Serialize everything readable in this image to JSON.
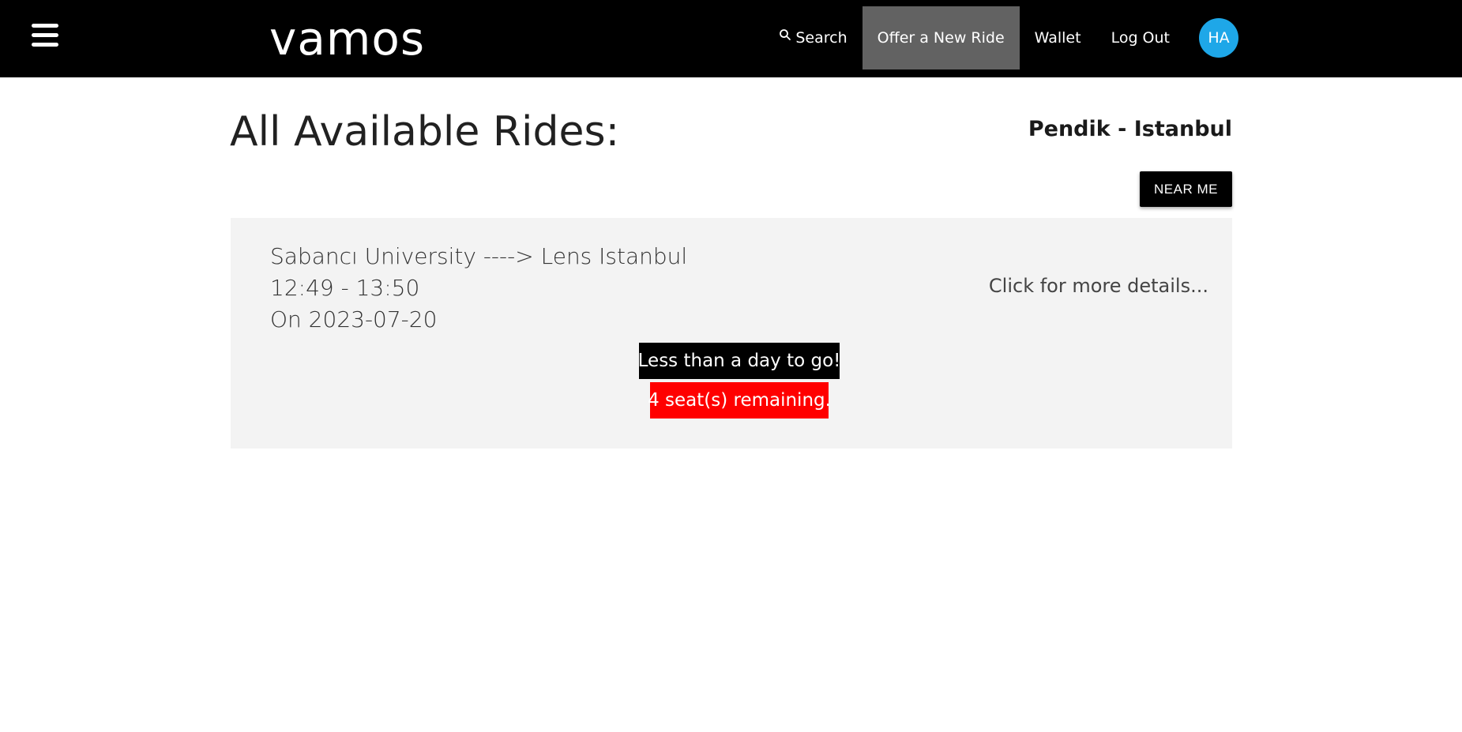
{
  "app": {
    "brand": "vamos"
  },
  "nav": {
    "search_label": "Search",
    "offer_label": "Offer a New Ride",
    "wallet_label": "Wallet",
    "logout_label": "Log Out",
    "avatar_initials": "HA"
  },
  "main": {
    "title": "All Available Rides:",
    "location": "Pendik - Istanbul",
    "near_me_label": "NEAR ME"
  },
  "rides": [
    {
      "route": "Sabancı University ----> Lens Istanbul",
      "time": "12:49 - 13:50",
      "date": "On 2023-07-20",
      "details_label": "Click for more details...",
      "time_badge": "Less than a day to go!",
      "seats_badge": "4 seat(s) remaining."
    }
  ],
  "colors": {
    "topbar": "#000000",
    "active_nav": "#626262",
    "avatar": "#1ea7e8",
    "card_bg": "#f3f3f3",
    "seats_badge": "#ff0000"
  },
  "icons": {
    "menu": "hamburger-menu-icon",
    "search": "search-icon"
  }
}
